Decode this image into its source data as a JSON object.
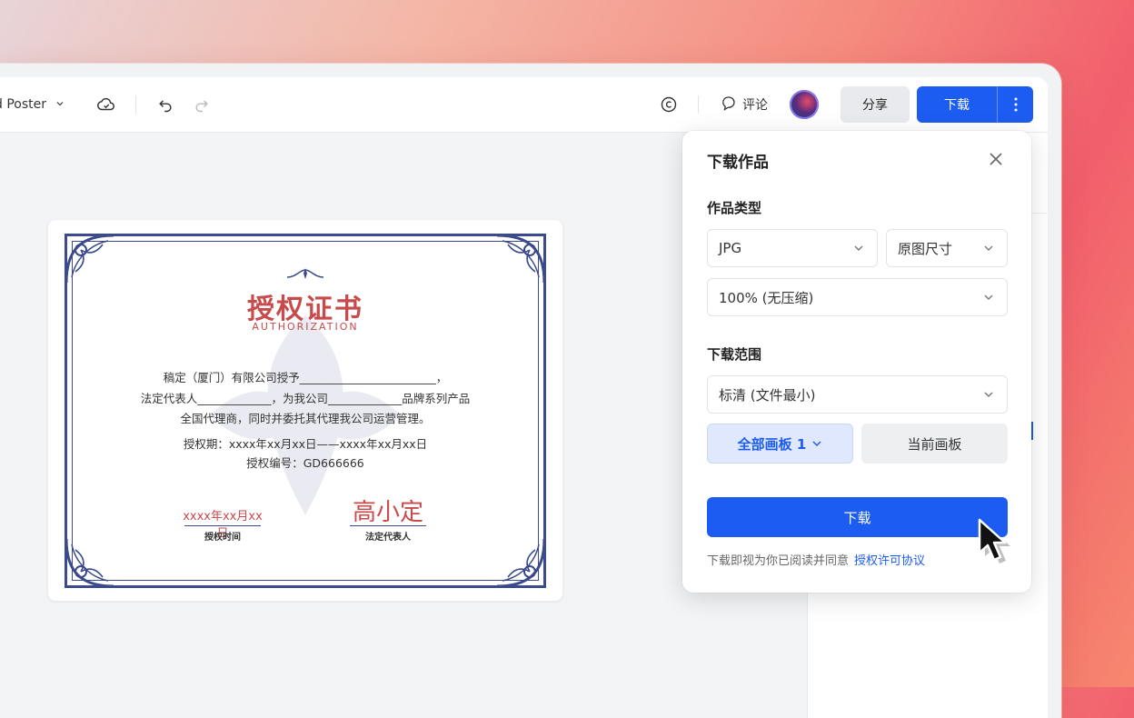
{
  "toolbar": {
    "doc_title": "d Poster",
    "comment_label": "评论",
    "share_label": "分享",
    "download_label": "下载"
  },
  "certificate": {
    "title": "授权证书",
    "subtitle": "AUTHORIZATION",
    "line1": "稿定（厦门）有限公司授予________________________，",
    "line2": "法定代表人_____________，为我公司_____________品牌系列产品",
    "line3": "全国代理商，同时并委托其代理我公司运营管理。",
    "period": "授权期：xxxx年xx月xx日——xxxx年xx月xx日",
    "number": "授权编号：GD666666",
    "date_value": "xxxx年xx月xx日",
    "date_label": "授权时间",
    "signature": "高小定",
    "signature_label": "法定代表人"
  },
  "dialog": {
    "title": "下载作品",
    "section_type": "作品类型",
    "format": "JPG",
    "size": "原图尺寸",
    "quality": "100% (无压缩)",
    "section_range": "下载范围",
    "resolution": "标清 (文件最小)",
    "all_boards": "全部画板 1",
    "current_board": "当前画板",
    "download_button": "下载",
    "agreement_prefix": "下载即视为你已阅读并同意",
    "agreement_link": "授权许可协议"
  },
  "colors": {
    "accent": "#1d5cf0",
    "cert_red": "#c94a4a",
    "cert_blue": "#3a4a8c"
  }
}
